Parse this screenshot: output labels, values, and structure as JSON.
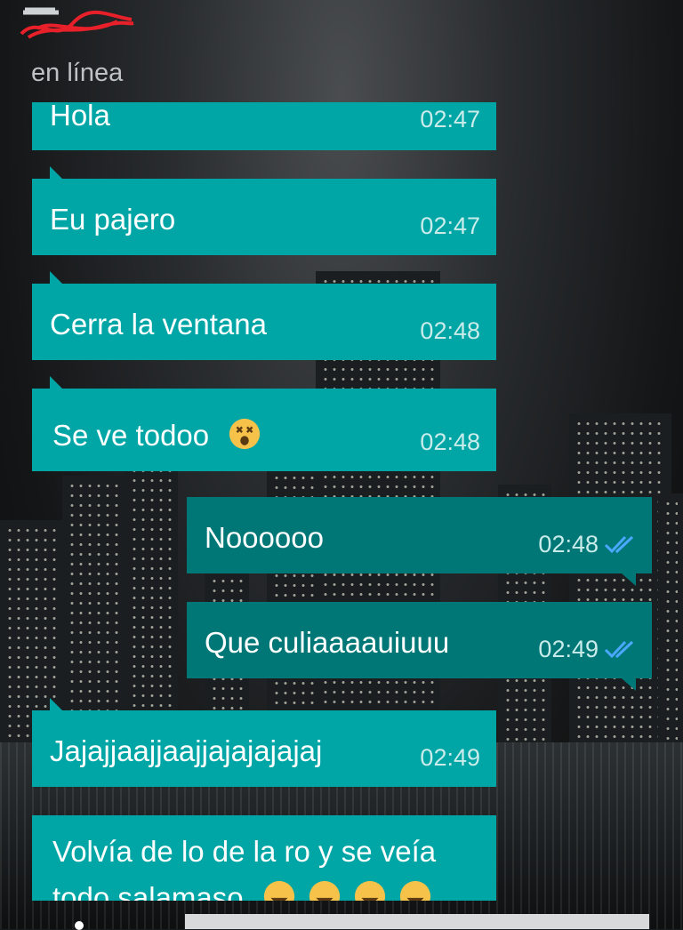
{
  "header": {
    "status": "en línea"
  },
  "messages": [
    {
      "id": 1,
      "direction": "incoming",
      "text": "Hola",
      "time": "02:47"
    },
    {
      "id": 2,
      "direction": "incoming",
      "text": "Eu pajero",
      "time": "02:47"
    },
    {
      "id": 3,
      "direction": "incoming",
      "text": "Cerra la ventana",
      "time": "02:48"
    },
    {
      "id": 4,
      "direction": "incoming",
      "text": "Se ve todoo",
      "time": "02:48",
      "emoji": "dizzy-face-emoji"
    },
    {
      "id": 5,
      "direction": "outgoing",
      "text": "Noooooo",
      "time": "02:48",
      "status": "read-double-check"
    },
    {
      "id": 6,
      "direction": "outgoing",
      "text": "Que culiaaaauiuuu",
      "time": "02:49",
      "status": "read-double-check"
    },
    {
      "id": 7,
      "direction": "incoming",
      "text": "Jajajjaajjaajjajajajajaj",
      "time": "02:49"
    },
    {
      "id": 8,
      "direction": "incoming",
      "text": "Volvía de lo de la ro y se veía",
      "text_line2": "todo salamaso",
      "emoji": [
        "grinning-emoji",
        "crying-laughing-emoji",
        "crying-laughing-emoji",
        "crying-laughing-emoji"
      ]
    }
  ],
  "colors": {
    "incoming_bubble": "#00a6a6",
    "outgoing_bubble": "#007777",
    "time_text": "#c9ecea",
    "read_check": "#4aa8ff"
  }
}
